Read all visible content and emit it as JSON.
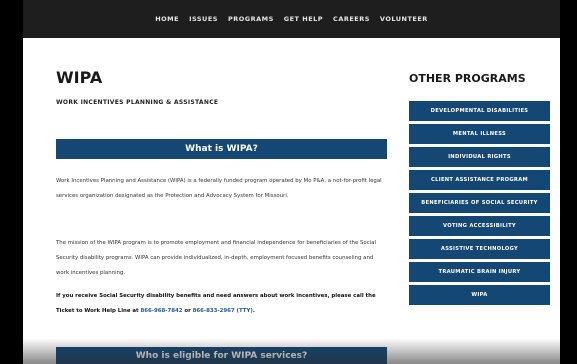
{
  "nav": {
    "items": [
      "HOME",
      "ISSUES",
      "PROGRAMS",
      "GET HELP",
      "CAREERS",
      "VOLUNTEER"
    ]
  },
  "main": {
    "title": "WIPA",
    "subtitle": "WORK INCENTIVES PLANNING & ASSISTANCE",
    "section1_heading": "What is WIPA?",
    "para1": "Work Incentives Planning and Assistance (WIPA) is a federally funded program operated by Mo P&A, a not-for-profit legal services organization designated as the Protection and Advocacy System for Missouri.",
    "para2": "The mission of the WIPA program is to promote employment and financial independence for beneficiaries of the Social Security disability programs. WIPA can provide individualized, in-depth, employment focused benefits counseling and work incentives planning.",
    "para3_text": "If you receive Social Security disability benefits and need answers about work incentives, please call the Ticket to Work Help Line at",
    "phone1": "866-968-7842",
    "para3_or": "or",
    "phone2": "866-833-2967 (TTY)",
    "para3_end": ".",
    "section2_heading": "Who is eligible for WIPA services?"
  },
  "sidebar": {
    "title": "OTHER PROGRAMS",
    "items": [
      "DEVELOPMENTAL DISABILITIES",
      "MENTAL ILLNESS",
      "INDIVIDUAL RIGHTS",
      "CLIENT ASSISTANCE PROGRAM",
      "BENEFICIARIES OF SOCIAL SECURITY",
      "VOTING ACCESSIBILITY",
      "ASSISTIVE TECHNOLOGY",
      "TRAUMATIC BRAIN INJURY",
      "WIPA"
    ]
  },
  "colors": {
    "accent": "#154774",
    "nav_bg": "#1e1e1e",
    "link": "#1c5a9c"
  }
}
